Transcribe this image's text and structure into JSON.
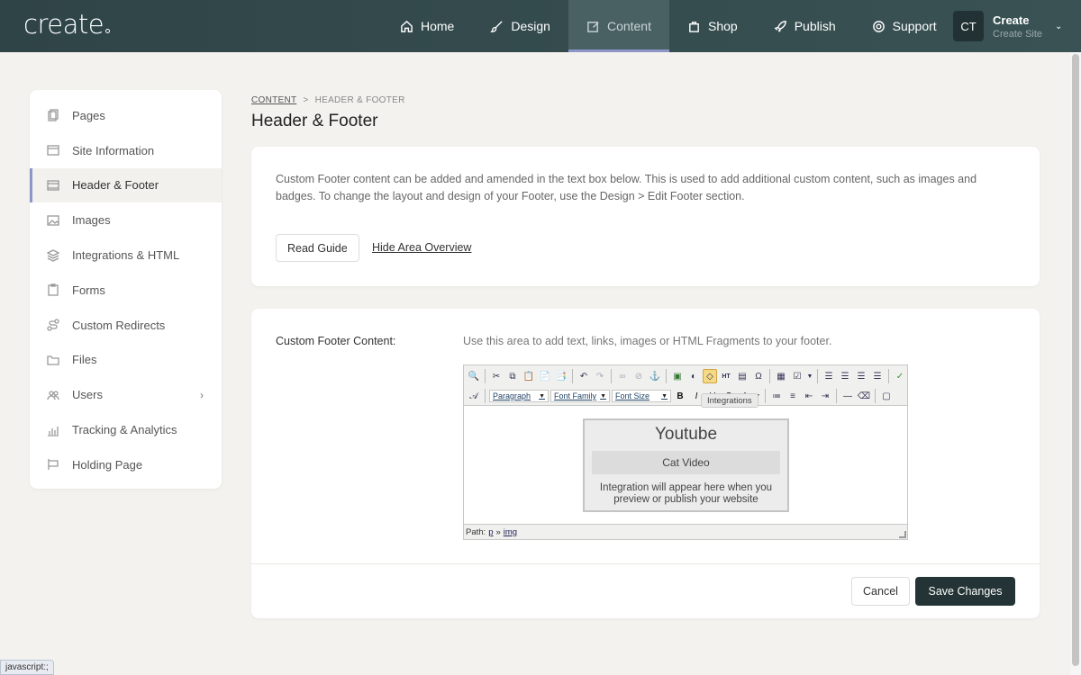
{
  "brand": {
    "logo": "create"
  },
  "nav": [
    {
      "label": "Home",
      "icon": "home-icon"
    },
    {
      "label": "Design",
      "icon": "brush-icon"
    },
    {
      "label": "Content",
      "icon": "edit-icon",
      "active": true
    },
    {
      "label": "Shop",
      "icon": "bag-icon"
    },
    {
      "label": "Publish",
      "icon": "rocket-icon"
    },
    {
      "label": "Support",
      "icon": "lifebuoy-icon"
    }
  ],
  "account": {
    "initials": "CT",
    "name": "Create",
    "subtitle": "Create Site"
  },
  "sidebar": {
    "items": [
      {
        "label": "Pages"
      },
      {
        "label": "Site Information"
      },
      {
        "label": "Header & Footer",
        "active": true
      },
      {
        "label": "Images"
      },
      {
        "label": "Integrations & HTML"
      },
      {
        "label": "Forms"
      },
      {
        "label": "Custom Redirects"
      },
      {
        "label": "Files"
      },
      {
        "label": "Users",
        "chevron": "›"
      },
      {
        "label": "Tracking & Analytics"
      },
      {
        "label": "Holding Page"
      }
    ]
  },
  "breadcrumb": {
    "root": "CONTENT",
    "separator": ">",
    "current": "HEADER & FOOTER"
  },
  "page": {
    "title": "Header & Footer"
  },
  "overview": {
    "description": "Custom Footer content can be added and amended in the text box below. This is used to add additional custom content, such as images and badges. To change the layout and design of your Footer, use the Design > Edit Footer section.",
    "read_guide": "Read Guide",
    "hide_overview": "Hide Area Overview"
  },
  "footer_field": {
    "label": "Custom Footer Content:",
    "help": "Use this area to add text, links, images or HTML Fragments to your footer."
  },
  "editor": {
    "format_select": "Paragraph",
    "font_family_select": "Font Family",
    "font_size_select": "Font Size",
    "tooltip": "Integrations",
    "embed": {
      "title": "Youtube",
      "video": "Cat Video",
      "note": "Integration will appear here when you preview or publish your website"
    },
    "status": {
      "path_label": "Path:",
      "path_p": "p",
      "path_sep": "»",
      "path_img": "img"
    }
  },
  "actions": {
    "cancel": "Cancel",
    "save": "Save Changes"
  },
  "browser_status": "javascript:;",
  "colors": {
    "nav_bg": "#2f4447",
    "accent": "#8e96c8",
    "save_bg": "#243335",
    "page_bg": "#f4f2ee"
  }
}
